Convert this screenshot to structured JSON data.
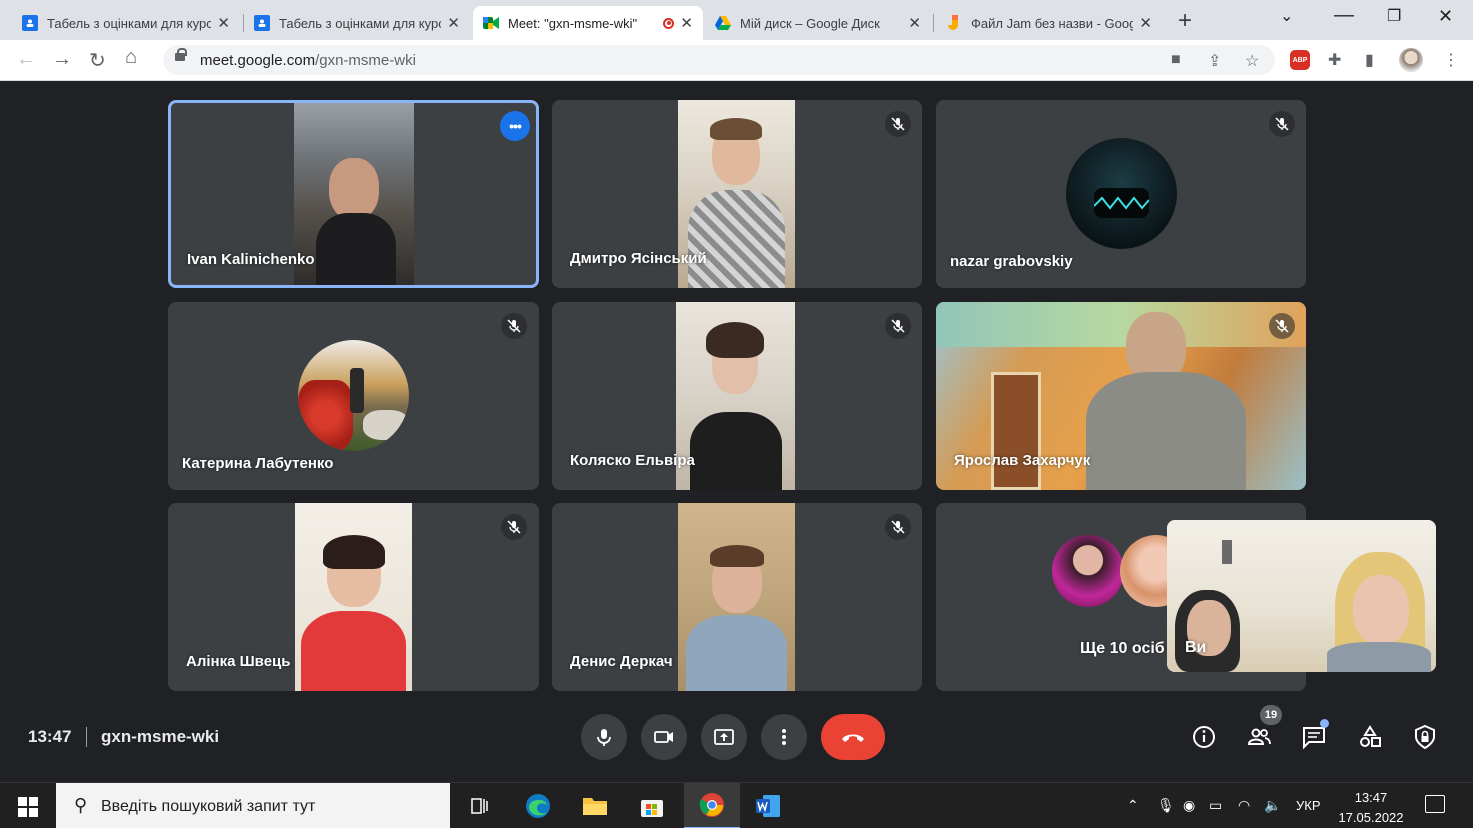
{
  "browser": {
    "tabs": [
      {
        "title": "Табель з оцінками для курсу",
        "icon": "google-classroom-icon",
        "color": "#1a73e8",
        "active": false
      },
      {
        "title": "Табель з оцінками для курсу",
        "icon": "google-classroom-icon",
        "color": "#1a73e8",
        "active": false
      },
      {
        "title": "Meet: \"gxn-msme-wki\"",
        "icon": "google-meet-icon",
        "active": true,
        "recording": true
      },
      {
        "title": "Мій диск – Google Диск",
        "icon": "google-drive-icon",
        "active": false
      },
      {
        "title": "Файл Jam без назви - Google Jamboard",
        "icon": "jamboard-icon",
        "color": "#f9ab00",
        "active": false
      }
    ],
    "address": {
      "host": "meet.google.com",
      "path": "/gxn-msme-wki"
    },
    "extensions": {
      "abp_label": "ABP"
    }
  },
  "meet": {
    "participants": [
      {
        "name": "Ivan Kalinichenko",
        "selected": true,
        "muted": false,
        "kind": "video"
      },
      {
        "name": "Дмитро Ясінський",
        "muted": true,
        "kind": "video"
      },
      {
        "name": "nazar grabovskiy",
        "muted": true,
        "kind": "avatar"
      },
      {
        "name": "Катерина Лабутенко",
        "muted": true,
        "kind": "avatar"
      },
      {
        "name": "Коляско Ельвіра",
        "muted": true,
        "kind": "video"
      },
      {
        "name": "Ярослав Захарчук",
        "muted": true,
        "kind": "video"
      },
      {
        "name": "Алінка Швець",
        "muted": true,
        "kind": "video"
      },
      {
        "name": "Денис Деркач",
        "muted": true,
        "kind": "video"
      }
    ],
    "others_label": "Ще 10 осіб",
    "self_label": "Ви",
    "clock": "13:47",
    "meeting_code": "gxn-msme-wki",
    "people_count": "19",
    "colors": {
      "end_call": "#ea4335",
      "selected_border": "#8ab4f8",
      "tile": "#3c4043",
      "background": "#202124"
    }
  },
  "taskbar": {
    "search_placeholder": "Введіть пошуковий запит тут",
    "language": "УКР",
    "time": "13:47",
    "date": "17.05.2022"
  }
}
